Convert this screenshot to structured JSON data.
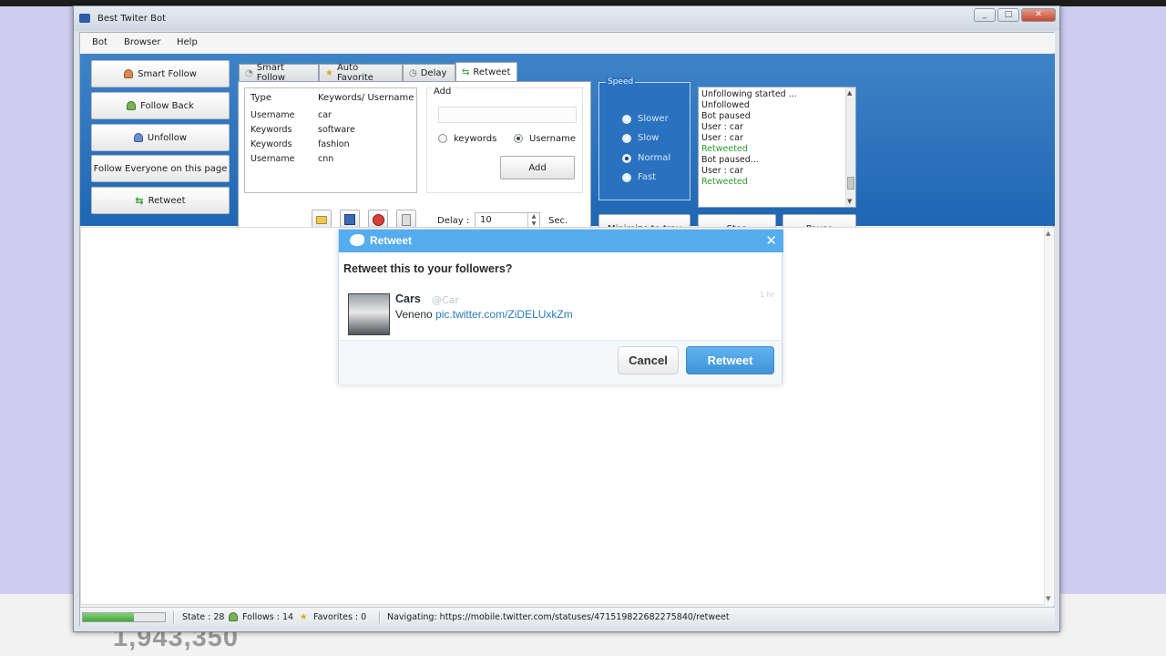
{
  "window": {
    "title": "Best Twiter Bot"
  },
  "menu": [
    "Bot",
    "Browser",
    "Help"
  ],
  "sidebar": {
    "items": [
      {
        "label": "Smart Follow",
        "icon": "user-icon"
      },
      {
        "label": "Follow Back",
        "icon": "user-icon"
      },
      {
        "label": "Unfollow",
        "icon": "user-icon"
      },
      {
        "label": "Follow Everyone on this page",
        "icon": ""
      },
      {
        "label": "Retweet",
        "icon": "retweet-icon"
      }
    ]
  },
  "tabs": [
    {
      "label": "Smart Follow",
      "icon": "user-icon"
    },
    {
      "label": "Auto Favorite",
      "icon": "star-icon"
    },
    {
      "label": "Delay",
      "icon": "clock-icon"
    },
    {
      "label": "Retweet",
      "icon": "retweet-icon",
      "active": true
    }
  ],
  "keywords_table": {
    "columns": [
      "Type",
      "Keywords/ Username"
    ],
    "rows": [
      [
        "Username",
        "car"
      ],
      [
        "Keywords",
        "software"
      ],
      [
        "Keywords",
        "fashion"
      ],
      [
        "Username",
        "cnn"
      ]
    ]
  },
  "add_panel": {
    "label": "Add",
    "input_value": "",
    "option_keywords": "keywords",
    "option_username": "Username",
    "selected": "Username",
    "add_button": "Add"
  },
  "delay": {
    "label": "Delay :",
    "value": "10",
    "unit": "Sec."
  },
  "speed": {
    "legend": "Speed",
    "options": [
      "Slower",
      "Slow",
      "Normal",
      "Fast"
    ],
    "selected": "Normal"
  },
  "log": [
    {
      "text": "Unfollowing started ...",
      "status": "normal"
    },
    {
      "text": "Unfollowed",
      "status": "normal"
    },
    {
      "text": "Bot paused",
      "status": "normal"
    },
    {
      "text": "User : car",
      "status": "normal"
    },
    {
      "text": "User : car",
      "status": "normal"
    },
    {
      "text": "Retweeted",
      "status": "success"
    },
    {
      "text": "Bot paused...",
      "status": "normal"
    },
    {
      "text": "User : car",
      "status": "normal"
    },
    {
      "text": "Retweeted",
      "status": "success"
    }
  ],
  "controls": {
    "minimize": "Minimize to tray",
    "stop": "Stop",
    "pause": "Pause"
  },
  "dialog": {
    "title": "Retweet",
    "question": "Retweet this to your followers?",
    "tweet": {
      "name": "Cars",
      "handle": "@Car",
      "time": "1 hr",
      "text": "Veneno",
      "link": "pic.twitter.com/ZiDELUxkZm"
    },
    "cancel": "Cancel",
    "retweet": "Retweet"
  },
  "status_bar": {
    "progress": 0.62,
    "state": "State : 28",
    "follows": "Follows : 14",
    "favorites": "Favorites : 0",
    "navigating": "Navigating: https://mobile.twitter.com/statuses/471519822682275840/retweet"
  },
  "background": {
    "counter": "1,943,350"
  },
  "colors": {
    "accent": "#2a72c0",
    "twitter_blue": "#55acee",
    "success": "#2f9a2f"
  }
}
